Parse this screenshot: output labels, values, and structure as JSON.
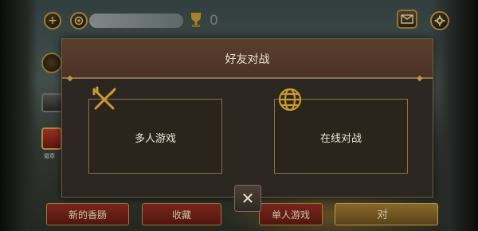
{
  "header": {
    "add_icon": "plus-icon",
    "coin_icon": "coin-icon",
    "trophy_icon": "trophy-icon",
    "trophy_count": "0",
    "mail_icon": "mailbox-icon",
    "settings_icon": "gear-icon"
  },
  "sidebar": {
    "items": [
      {
        "icon": "medal-icon"
      },
      {
        "icon": "book-icon"
      },
      {
        "icon": "badge-icon",
        "label": "徽章"
      }
    ]
  },
  "bottom_tabs": [
    {
      "label": "新的香肠"
    },
    {
      "label": "收藏"
    },
    {
      "label": "单人游戏"
    },
    {
      "label": "对"
    }
  ],
  "dialog": {
    "title": "好友对战",
    "options": [
      {
        "label": "多人游戏",
        "icon": "fork-knife-icon"
      },
      {
        "label": "在线对战",
        "icon": "globe-icon"
      }
    ],
    "close_label": "✕"
  },
  "colors": {
    "dialog_bg": "#2c2620",
    "header_bg": "#4a3225",
    "accent_gold": "#c89a2f",
    "tab_red": "#8e2e22"
  }
}
